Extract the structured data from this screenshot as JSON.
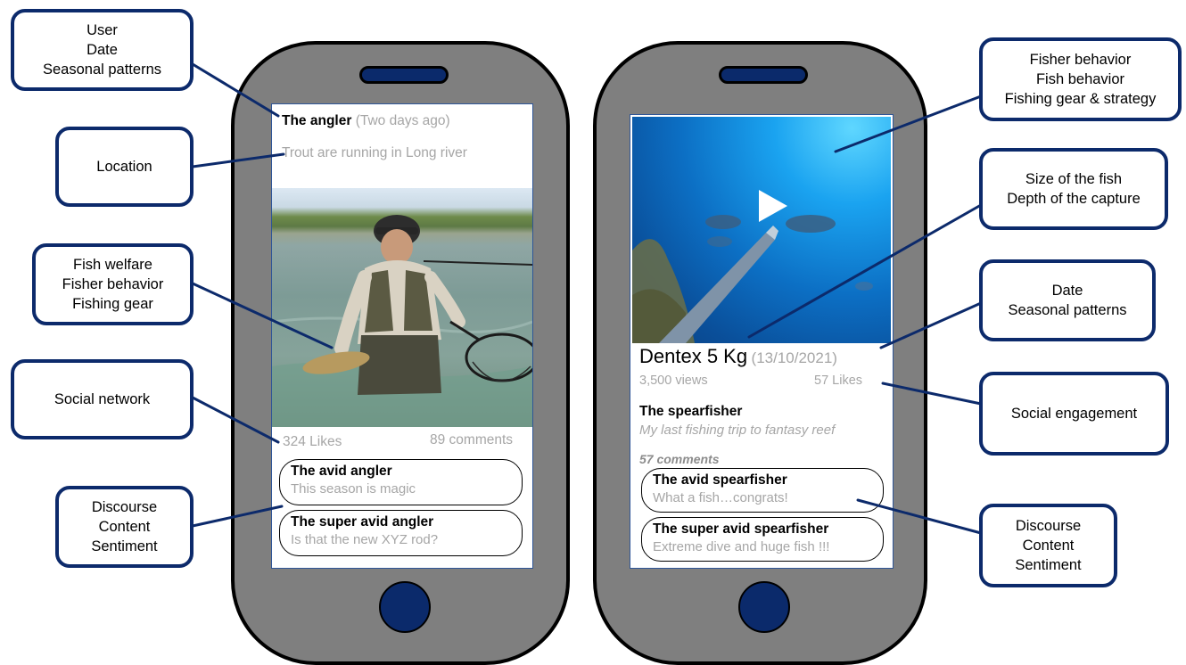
{
  "left_phone": {
    "post_user": "The angler",
    "post_time": "Two days ago",
    "post_text": "Trout are running in Long river",
    "likes": "324 Likes",
    "comments_count": "89 comments",
    "comments": [
      {
        "name": "The avid angler",
        "text": "This season is magic"
      },
      {
        "name": "The super avid angler",
        "text": "Is that the new XYZ rod?"
      }
    ]
  },
  "right_phone": {
    "video_title": "Dentex 5 Kg",
    "video_date": "(13/10/2021)",
    "views": "3,500 views",
    "likes": "57 Likes",
    "post_user": "The spearfisher",
    "post_text": "My last fishing trip to fantasy reef",
    "comments_count": "57 comments",
    "comments": [
      {
        "name": "The avid spearfisher",
        "text": "What a fish…congrats!"
      },
      {
        "name": "The super avid spearfisher",
        "text": "Extreme dive and huge fish !!!"
      }
    ]
  },
  "callouts": {
    "user_date": [
      "User",
      "Date",
      "Seasonal patterns"
    ],
    "location": [
      "Location"
    ],
    "fish_welfare": [
      "Fish welfare",
      "Fisher behavior",
      "Fishing gear"
    ],
    "social_network": [
      "Social network"
    ],
    "discourse_left": [
      "Discourse",
      "Content",
      "Sentiment"
    ],
    "fisher_behavior": [
      "Fisher behavior",
      "Fish behavior",
      "Fishing gear & strategy"
    ],
    "size_depth": [
      "Size of the fish",
      "Depth of the capture"
    ],
    "date_seasonal": [
      "Date",
      "Seasonal patterns"
    ],
    "social_engagement": [
      "Social engagement"
    ],
    "discourse_right": [
      "Discourse",
      "Content",
      "Sentiment"
    ]
  },
  "colors": {
    "callout_border": "#0c2a6b",
    "phone_body": "#7f7f7f",
    "accent_button": "#0b2a6b",
    "secondary_text": "#a6a6a6"
  }
}
